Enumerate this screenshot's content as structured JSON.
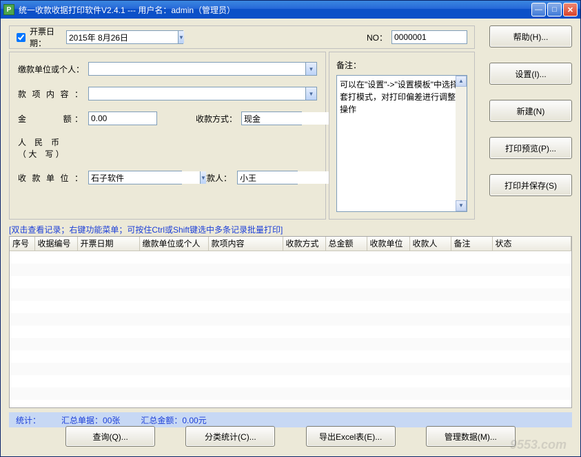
{
  "titlebar": {
    "icon_text": "P",
    "title": "统一收款收据打印软件V2.4.1 --- 用户名：admin（管理员）"
  },
  "top": {
    "date_checkbox_label": "开票日期：",
    "date_value": "2015年 8月26日",
    "no_label": "NO：",
    "no_value": "0000001"
  },
  "form": {
    "payer_label": "缴款单位或个人：",
    "payer_value": "",
    "item_label": "款 项 内 容 ：",
    "item_value": "",
    "amount_label": "金　　　额：",
    "amount_value": "0.00",
    "paymethod_label": "收款方式：",
    "paymethod_value": "现金",
    "rmb_label_1": "人　民　币",
    "rmb_label_2": "（ 大　写 ）",
    "rmb_value": "",
    "payee_unit_label": "收 款 单 位 ：",
    "payee_unit_value": "石子软件",
    "payee_person_label": "收款人：",
    "payee_person_value": "小王"
  },
  "memo": {
    "label": "备注：",
    "text": "可以在\"设置\"->\"设置模板\"中选择套打模式，对打印偏差进行调整等操作"
  },
  "side_buttons": {
    "help": "帮助(H)...",
    "settings": "设置(I)...",
    "new": "新建(N)",
    "preview": "打印预览(P)...",
    "print_save": "打印并保存(S)"
  },
  "hint": "[双击查看记录；右键功能菜单；可按住Ctrl或Shift键选中多条记录批量打印]",
  "table": {
    "columns": [
      "序号",
      "收据编号",
      "开票日期",
      "缴款单位或个人",
      "款项内容",
      "收款方式",
      "总金额",
      "收款单位",
      "收款人",
      "备注",
      "状态"
    ]
  },
  "summary": {
    "label": "统计：",
    "docs": "汇总单据：00张",
    "amount": "汇总金额：0.00元"
  },
  "bottom_buttons": {
    "query": "查询(Q)...",
    "stats": "分类统计(C)...",
    "export": "导出Excel表(E)...",
    "manage": "管理数据(M)..."
  },
  "watermark": "9553.com"
}
